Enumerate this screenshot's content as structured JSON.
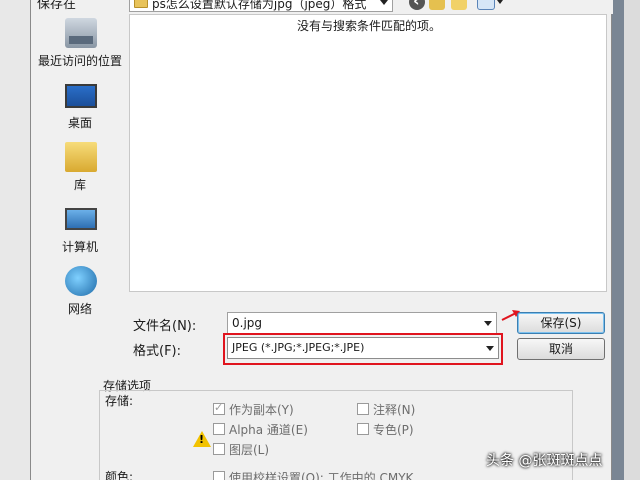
{
  "toolbar": {
    "save_in_label": "保存在",
    "current_folder": "ps怎么设置默认存储为jpg（jpeg）格式"
  },
  "places": [
    {
      "label": "最近访问的位置",
      "icon": "recent-places-icon"
    },
    {
      "label": "桌面",
      "icon": "desktop-icon"
    },
    {
      "label": "库",
      "icon": "library-icon"
    },
    {
      "label": "计算机",
      "icon": "computer-icon"
    },
    {
      "label": "网络",
      "icon": "network-icon"
    }
  ],
  "filelist": {
    "empty_message": "没有与搜索条件匹配的项。"
  },
  "filename": {
    "label": "文件名(N):",
    "value": "0.jpg"
  },
  "format": {
    "label": "格式(F):",
    "value": "JPEG (*.JPG;*.JPEG;*.JPE)"
  },
  "buttons": {
    "save": "保存(S)",
    "cancel": "取消"
  },
  "save_options": {
    "header": "存储选项",
    "storage_label": "存储:",
    "as_copy": "作为副本(Y)",
    "notes": "注释(N)",
    "alpha": "Alpha 通道(E)",
    "spot": "专色(P)",
    "layers": "图层(L)",
    "color_label": "颜色:",
    "proof": "使用校样设置(O): 工作中的 CMYK"
  },
  "watermark": "头条 @张斑斑点点",
  "colors": {
    "highlight": "#e0141e",
    "accent": "#3c7fb1"
  }
}
